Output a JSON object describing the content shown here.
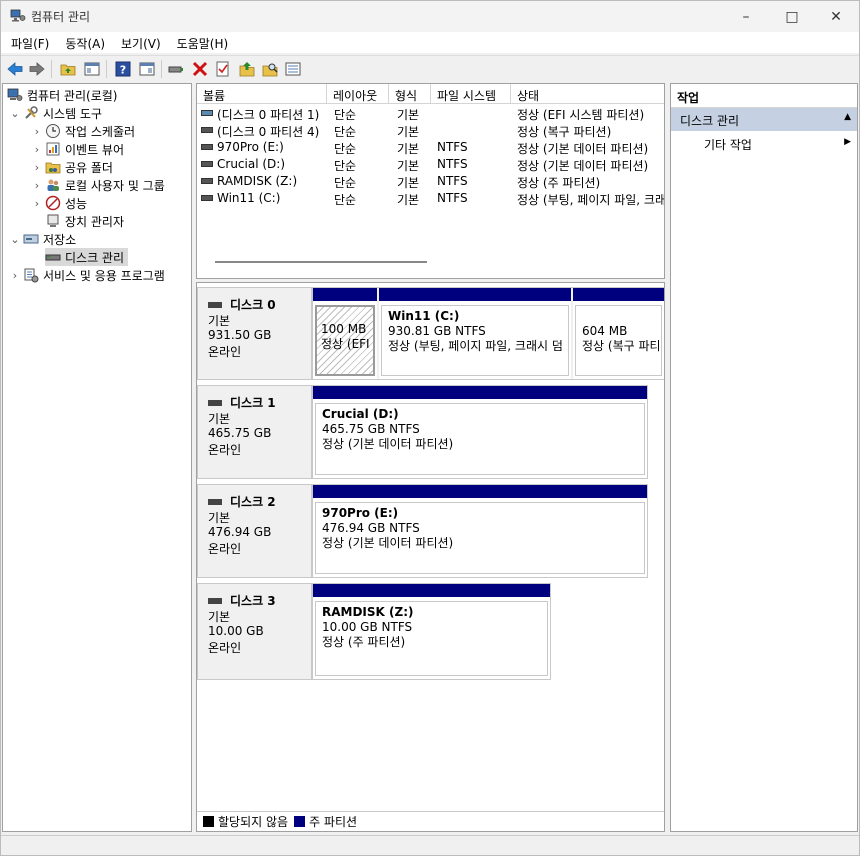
{
  "window": {
    "title": "컴퓨터 관리"
  },
  "menu": [
    "파일(F)",
    "동작(A)",
    "보기(V)",
    "도움말(H)"
  ],
  "toolbar_icons": [
    "back-icon",
    "forward-icon",
    "up-folder-icon",
    "show-hide-tree-icon",
    "help-icon",
    "show-hide-action-icon",
    "connect-icon",
    "delete-icon",
    "properties-icon",
    "export-icon",
    "search-icon",
    "list-icon"
  ],
  "tree": {
    "root": "컴퓨터 관리(로컬)",
    "system_tools": "시스템 도구",
    "task_scheduler": "작업 스케줄러",
    "event_viewer": "이벤트 뷰어",
    "shared_folders": "공유 폴더",
    "local_users": "로컬 사용자 및 그룹",
    "performance": "성능",
    "device_manager": "장치 관리자",
    "storage": "저장소",
    "disk_management": "디스크 관리",
    "services": "서비스 및 응용 프로그램"
  },
  "volume_list": {
    "columns": [
      "볼륨",
      "레이아웃",
      "형식",
      "파일 시스템",
      "상태"
    ],
    "rows": [
      [
        "(디스크 0 파티션 1)",
        "단순",
        "기본",
        "",
        "정상 (EFI 시스템 파티션)"
      ],
      [
        "(디스크 0 파티션 4)",
        "단순",
        "기본",
        "",
        "정상 (복구 파티션)"
      ],
      [
        "970Pro (E:)",
        "단순",
        "기본",
        "NTFS",
        "정상 (기본 데이터 파티션)"
      ],
      [
        "Crucial (D:)",
        "단순",
        "기본",
        "NTFS",
        "정상 (기본 데이터 파티션)"
      ],
      [
        "RAMDISK (Z:)",
        "단순",
        "기본",
        "NTFS",
        "정상 (주 파티션)"
      ],
      [
        "Win11 (C:)",
        "단순",
        "기본",
        "NTFS",
        "정상 (부팅, 페이지 파일, 크래시"
      ]
    ]
  },
  "disks": [
    {
      "name": "디스크 0",
      "type": "기본",
      "size": "931.50 GB",
      "status": "온라인",
      "partitions": [
        {
          "title": "",
          "size": "100 MB",
          "status": "정상 (EFI"
        },
        {
          "title": "Win11  (C:)",
          "size": "930.81 GB NTFS",
          "status": "정상 (부팅, 페이지 파일, 크래시 덤"
        },
        {
          "title": "",
          "size": "604 MB",
          "status": "정상 (복구 파티"
        }
      ]
    },
    {
      "name": "디스크 1",
      "type": "기본",
      "size": "465.75 GB",
      "status": "온라인",
      "partitions": [
        {
          "title": "Crucial  (D:)",
          "size": "465.75 GB NTFS",
          "status": "정상 (기본 데이터 파티션)"
        }
      ]
    },
    {
      "name": "디스크 2",
      "type": "기본",
      "size": "476.94 GB",
      "status": "온라인",
      "partitions": [
        {
          "title": "970Pro  (E:)",
          "size": "476.94 GB NTFS",
          "status": "정상 (기본 데이터 파티션)"
        }
      ]
    },
    {
      "name": "디스크 3",
      "type": "기본",
      "size": "10.00 GB",
      "status": "온라인",
      "partitions": [
        {
          "title": "RAMDISK  (Z:)",
          "size": "10.00 GB NTFS",
          "status": "정상 (주 파티션)"
        }
      ]
    }
  ],
  "legend": {
    "unallocated": "할당되지 않음",
    "primary": "주 파티션",
    "unallocated_color": "#000000",
    "primary_color": "#00007e"
  },
  "actions": {
    "header": "작업",
    "section": "디스크 관리",
    "more": "기타 작업"
  }
}
